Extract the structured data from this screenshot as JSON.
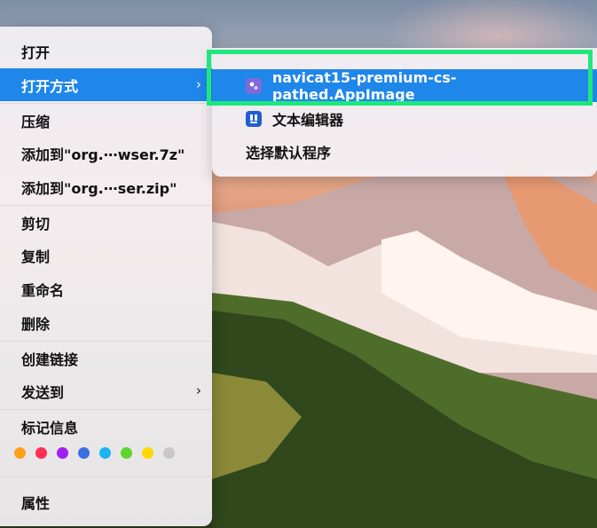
{
  "context_menu": {
    "items": [
      {
        "label": "打开"
      },
      {
        "label": "打开方式",
        "has_submenu": true,
        "arrow": "›"
      },
      {
        "label": "压缩"
      },
      {
        "label": "添加到\"org.⋯wser.7z\""
      },
      {
        "label": "添加到\"org.⋯ser.zip\""
      },
      {
        "label": "剪切"
      },
      {
        "label": "复制"
      },
      {
        "label": "重命名"
      },
      {
        "label": "删除"
      },
      {
        "label": "创建链接"
      },
      {
        "label": "发送到",
        "has_submenu": true,
        "arrow": "›"
      },
      {
        "label": "标记信息"
      },
      {
        "label": "属性"
      }
    ],
    "tag_colors": [
      "#ff9f1a",
      "#ff2d55",
      "#a020f0",
      "#3b6fe0",
      "#19b5f0",
      "#5cd62b",
      "#ffd800",
      "#c8c8c8"
    ]
  },
  "open_with_submenu": {
    "items": [
      {
        "label": "navicat15-premium-cs-pathed.AppImage",
        "icon": "appimage-icon"
      },
      {
        "label": "文本编辑器",
        "icon": "text-editor-icon"
      },
      {
        "label": "选择默认程序"
      }
    ]
  },
  "colors": {
    "accent": "#1f86ea",
    "highlight_box": "#1ee87d"
  }
}
